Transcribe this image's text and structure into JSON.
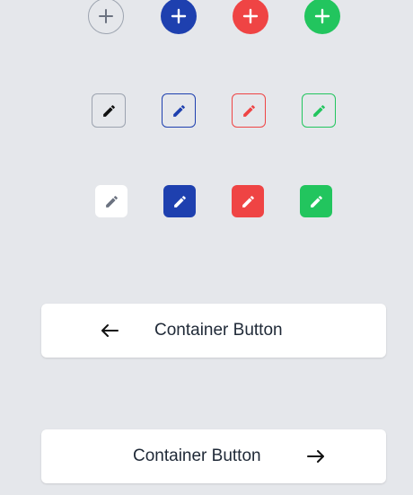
{
  "colors": {
    "background": "#e5e7eb",
    "neutral_border": "#9ca3af",
    "neutral_icon": "#6b7280",
    "primary": "#1e40af",
    "danger": "#ef4444",
    "success": "#22c55e",
    "white": "#ffffff",
    "text": "#1f2937"
  },
  "rows": {
    "plus_circle_buttons": [
      {
        "variant": "outline",
        "icon": "plus-icon"
      },
      {
        "variant": "primary",
        "icon": "plus-icon"
      },
      {
        "variant": "danger",
        "icon": "plus-icon"
      },
      {
        "variant": "success",
        "icon": "plus-icon"
      }
    ],
    "edit_outline_buttons": [
      {
        "variant": "neutral",
        "icon": "pencil-icon"
      },
      {
        "variant": "primary",
        "icon": "pencil-icon"
      },
      {
        "variant": "danger",
        "icon": "pencil-icon"
      },
      {
        "variant": "success",
        "icon": "pencil-icon"
      }
    ],
    "edit_solid_buttons": [
      {
        "variant": "white",
        "icon": "pencil-icon"
      },
      {
        "variant": "primary",
        "icon": "pencil-icon"
      },
      {
        "variant": "danger",
        "icon": "pencil-icon"
      },
      {
        "variant": "success",
        "icon": "pencil-icon"
      }
    ]
  },
  "container_buttons": [
    {
      "label": "Container Button",
      "icon": "arrow-left-icon"
    },
    {
      "label": "Container Button",
      "icon": "arrow-right-icon"
    }
  ]
}
